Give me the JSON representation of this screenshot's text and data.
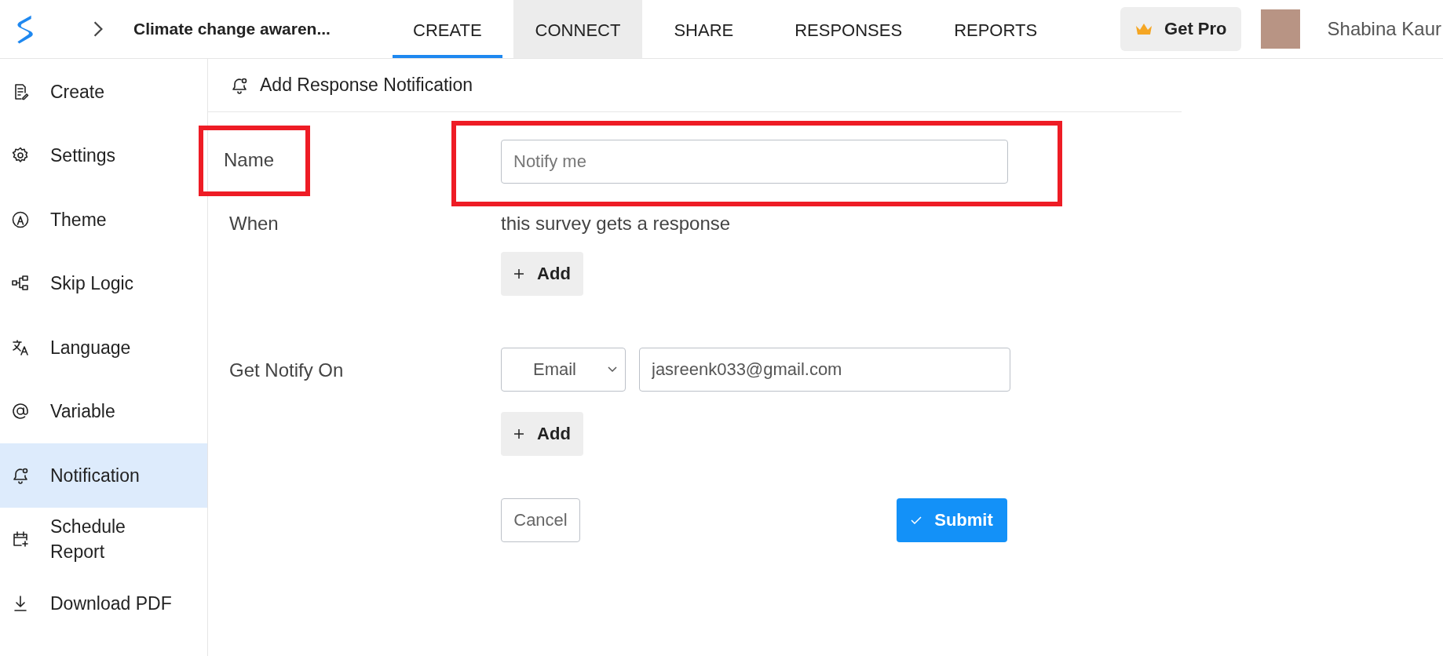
{
  "header": {
    "survey_title": "Climate change awaren...",
    "tabs": [
      {
        "label": "CREATE",
        "selected": true,
        "hovered": false
      },
      {
        "label": "CONNECT",
        "selected": false,
        "hovered": true
      },
      {
        "label": "SHARE",
        "selected": false,
        "hovered": false
      },
      {
        "label": "RESPONSES",
        "selected": false,
        "hovered": false
      },
      {
        "label": "REPORTS",
        "selected": false,
        "hovered": false
      }
    ],
    "get_pro": "Get Pro",
    "user_name": "Shabina Kaur"
  },
  "sidebar": {
    "items": [
      {
        "label": "Create",
        "selected": false
      },
      {
        "label": "Settings",
        "selected": false
      },
      {
        "label": "Theme",
        "selected": false
      },
      {
        "label": "Skip Logic",
        "selected": false
      },
      {
        "label": "Language",
        "selected": false
      },
      {
        "label": "Variable",
        "selected": false
      },
      {
        "label": "Notification",
        "selected": true
      },
      {
        "label": "Schedule\nReport",
        "selected": false
      },
      {
        "label": "Download PDF",
        "selected": false
      }
    ]
  },
  "panel": {
    "title": "Add Response Notification",
    "name_row": {
      "label": "Name",
      "placeholder": "Notify me",
      "label_highlighted": true,
      "field_highlighted": true
    },
    "when_row": {
      "label": "When",
      "text": "this survey gets a response",
      "add_button": "Add"
    },
    "notify_row": {
      "label": "Get Notify On",
      "channel": "Email",
      "address": "jasreenk033@gmail.com",
      "add_button": "Add"
    },
    "cancel_button": "Cancel",
    "submit_button": "Submit"
  }
}
